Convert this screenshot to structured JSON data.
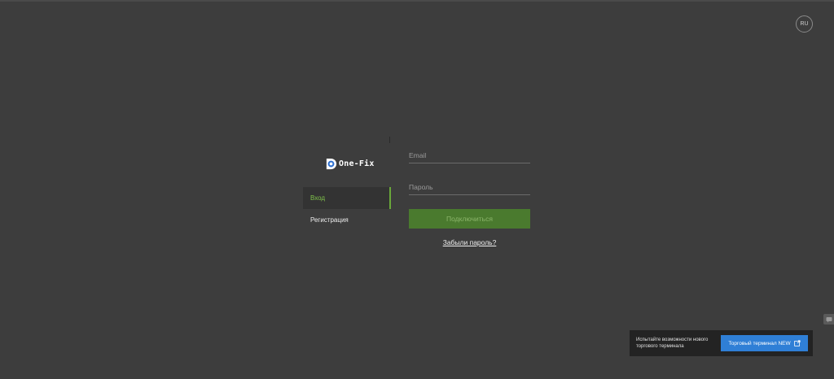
{
  "header": {
    "language": "RU"
  },
  "brand": {
    "name": "One-Fix",
    "icon": "one-fix-logo-mark"
  },
  "nav": {
    "items": [
      {
        "label": "Вход",
        "active": true
      },
      {
        "label": "Регистрация",
        "active": false
      }
    ]
  },
  "login_form": {
    "email_placeholder": "Email",
    "password_placeholder": "Пароль",
    "submit_label": "Подключиться",
    "forgot_label": "Забыли пароль?"
  },
  "promo": {
    "text": "Испытайте возможности нового торгового терминала",
    "button_label": "Торговый терминал NEW",
    "button_icon": "external-link-icon"
  },
  "colors": {
    "background": "#3d3d3d",
    "accent_green": "#7fc24a",
    "button_green": "#4a7a2e",
    "promo_blue": "#2f7fd6"
  }
}
